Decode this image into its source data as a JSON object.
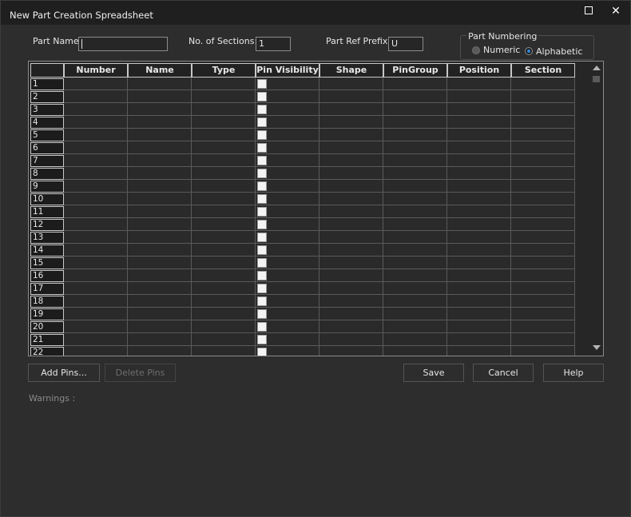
{
  "window": {
    "title": "New Part Creation Spreadsheet"
  },
  "titlebar": {
    "close_glyph": "✕"
  },
  "form": {
    "part_name_label": "Part Name:",
    "part_name_value": "",
    "sections_label": "No. of Sections:",
    "sections_value": "1",
    "prefix_label": "Part Ref Prefix:",
    "prefix_value": "U"
  },
  "numbering": {
    "title": "Part Numbering",
    "options": [
      {
        "label": "Numeric",
        "selected": false
      },
      {
        "label": "Alphabetic",
        "selected": true
      }
    ]
  },
  "grid": {
    "columns": [
      "Number",
      "Name",
      "Type",
      "Pin Visibility",
      "Shape",
      "PinGroup",
      "Position",
      "Section"
    ],
    "rows": [
      "1",
      "2",
      "3",
      "4",
      "5",
      "6",
      "7",
      "8",
      "9",
      "10",
      "11",
      "12",
      "13",
      "14",
      "15",
      "16",
      "17",
      "18",
      "19",
      "20",
      "21",
      "22"
    ]
  },
  "buttons": {
    "add_pins": "Add Pins...",
    "delete_pins": "Delete Pins",
    "save": "Save",
    "cancel": "Cancel",
    "help": "Help"
  },
  "warnings_label": "Warnings :",
  "colors": {
    "accent": "#2e8ce0",
    "background": "#2d2d2d",
    "titlebar": "#1f1f1f"
  }
}
